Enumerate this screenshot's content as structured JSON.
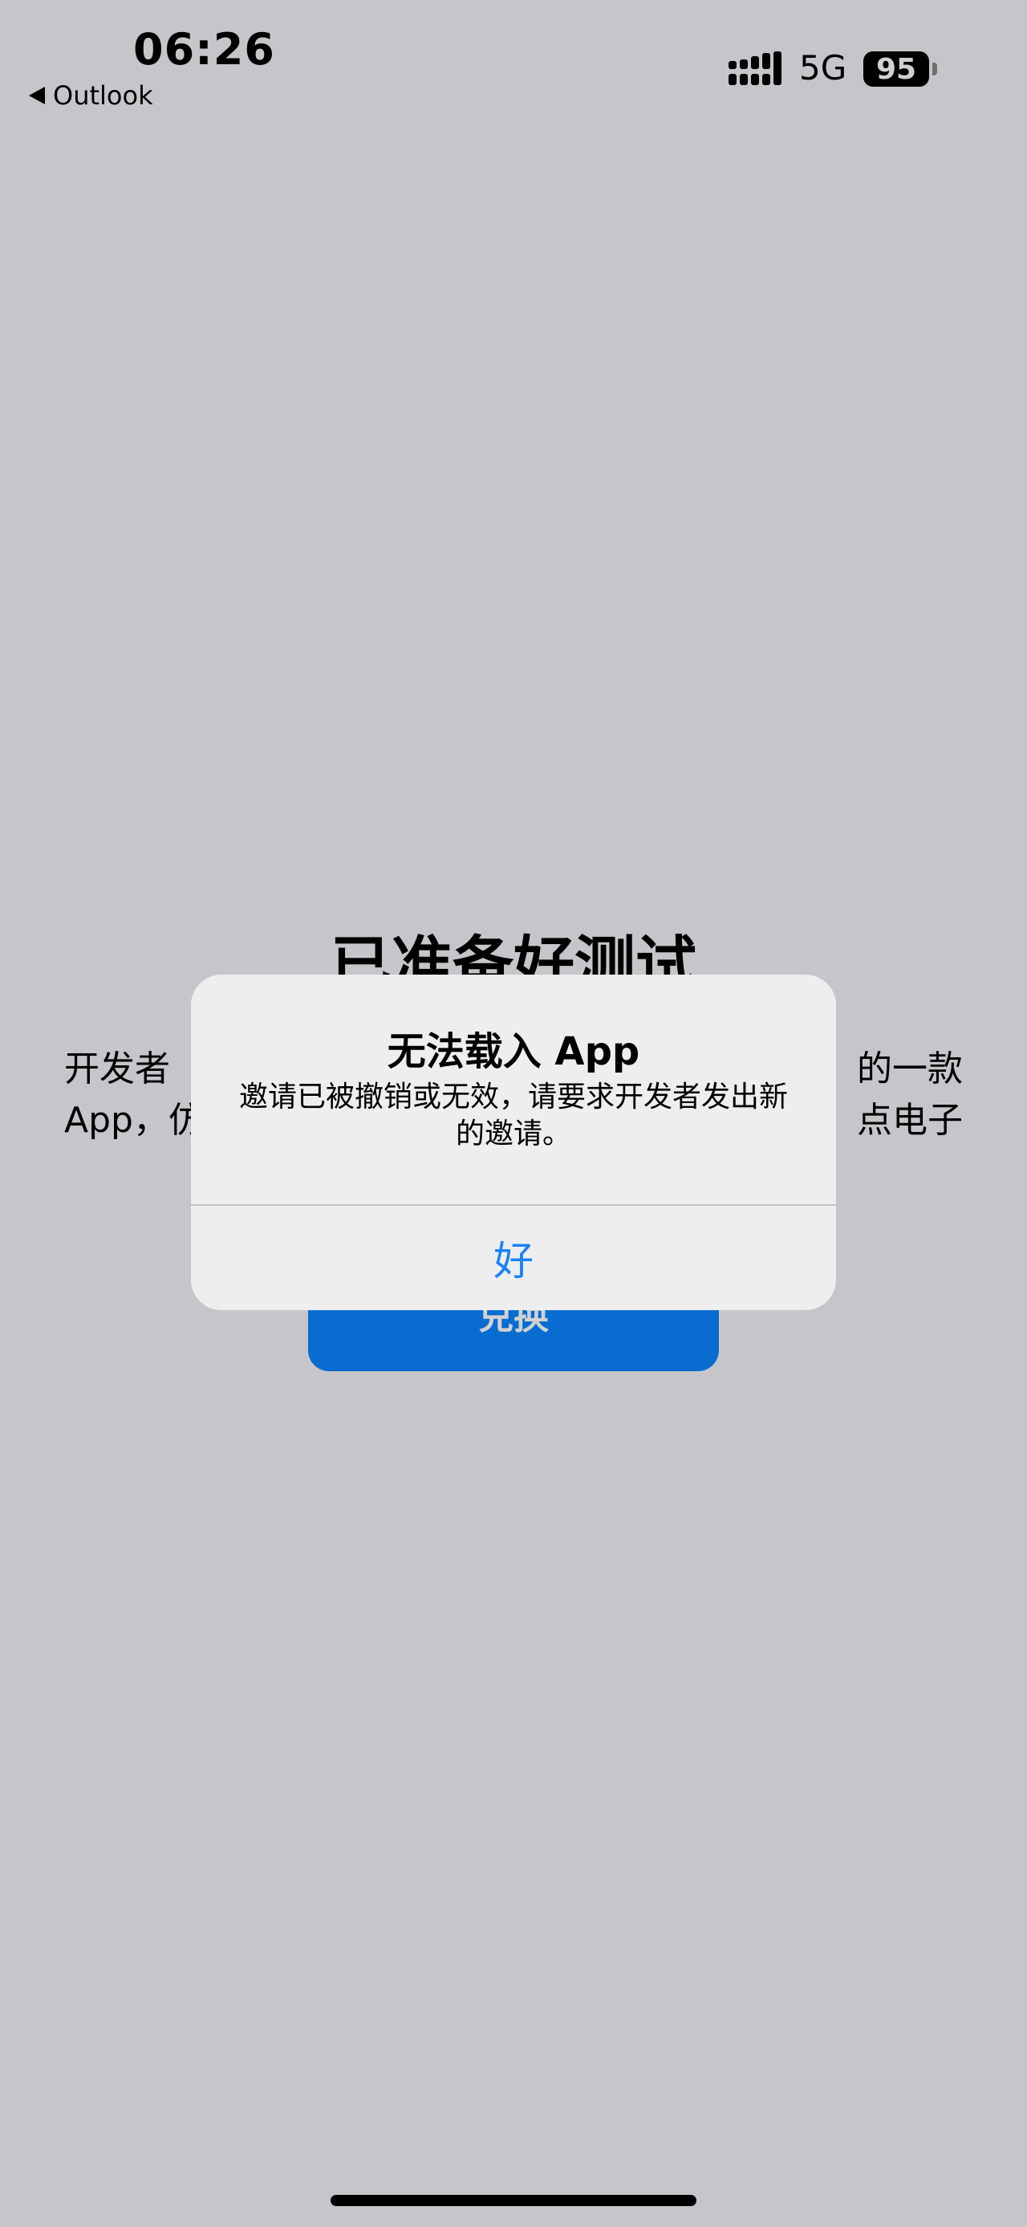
{
  "status_bar": {
    "time": "06:26",
    "back_app": "Outlook",
    "network": "5G",
    "battery": "95",
    "signal_icon": "signal-bars-icon"
  },
  "page": {
    "title": "已准备好测试",
    "description_lines": [
      "开发者",
      "的一款",
      "App，仿",
      "点电子"
    ],
    "button_label": "兑换"
  },
  "alert": {
    "title": "无法载入 App",
    "message": "邀请已被撤销或无效，请要求开发者发出新的邀请。",
    "ok_label": "好"
  },
  "colors": {
    "accent": "#1a82f7",
    "button_blue": "#0a84ff",
    "alert_bg": "#eeeeee",
    "page_bg": "#f2f2f7"
  }
}
